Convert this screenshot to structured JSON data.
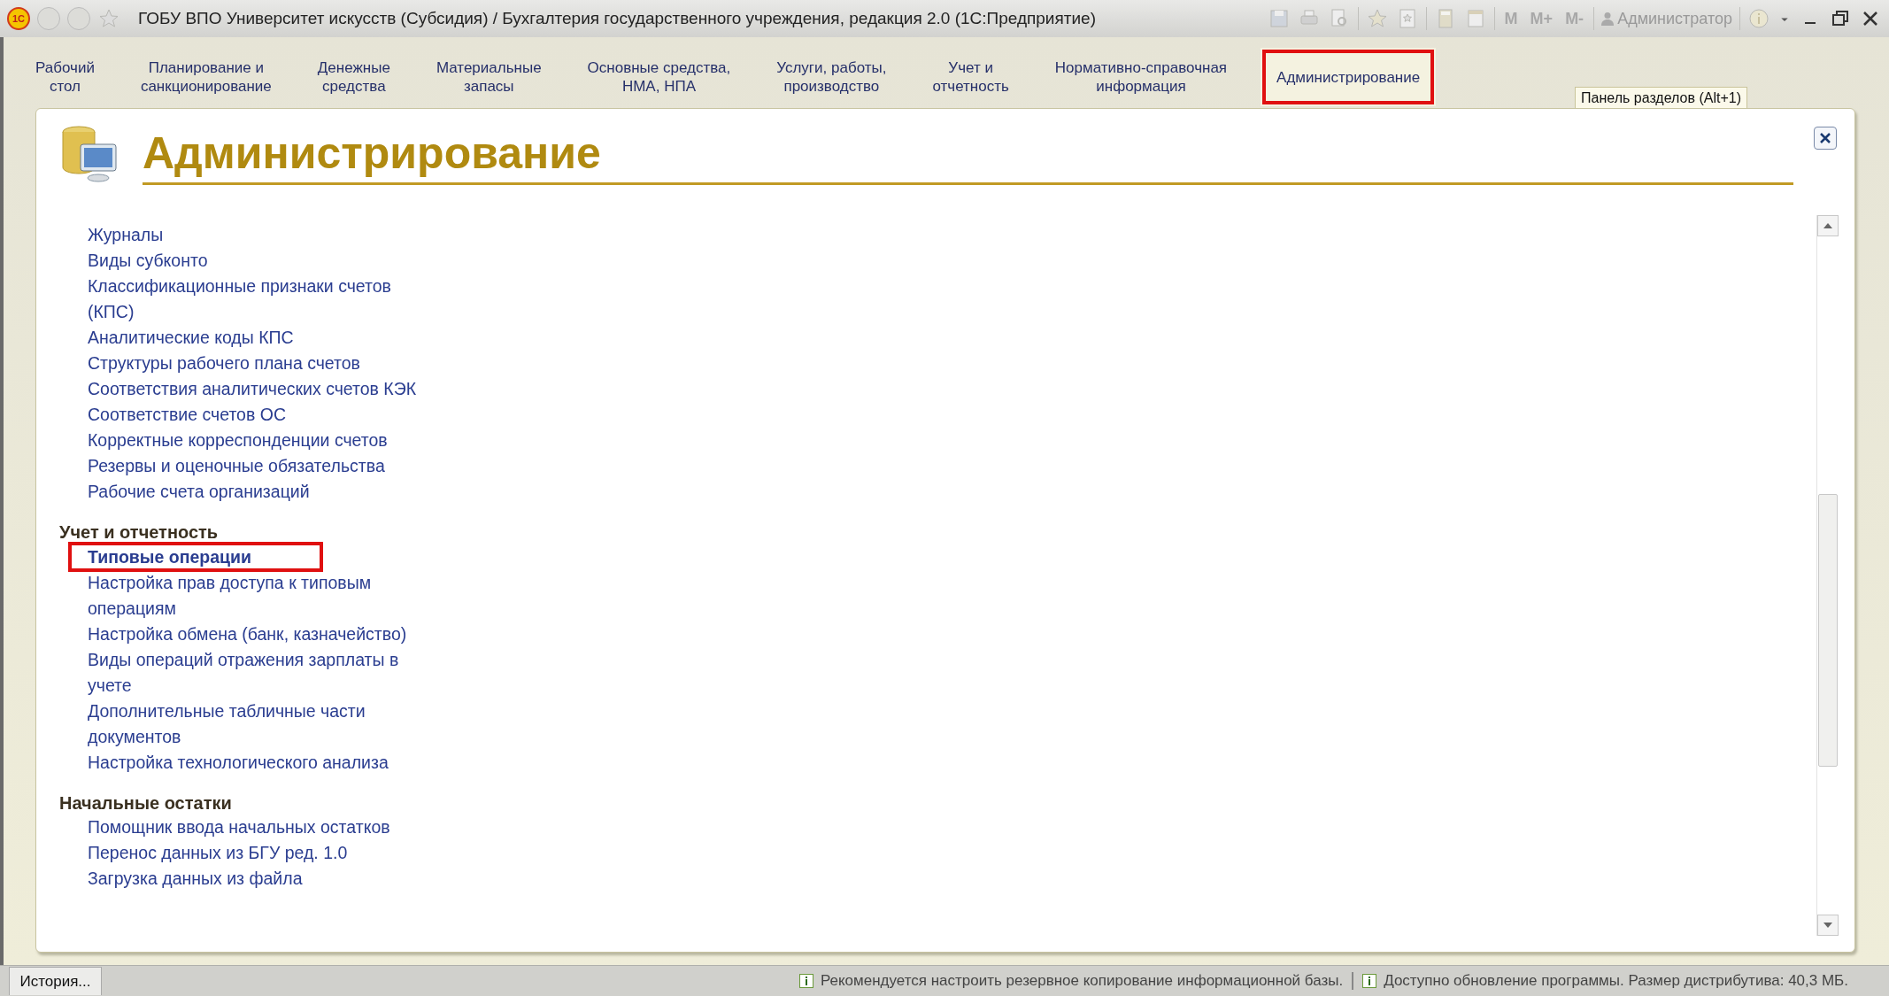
{
  "window": {
    "logo": "1С",
    "title": "ГОБУ ВПО Университет искусств (Субсидия) / Бухгалтерия государственного учреждения, редакция 2.0  (1С:Предприятие)",
    "memory_buttons": [
      "M",
      "M+",
      "M-"
    ],
    "user": "Администратор"
  },
  "sections": [
    {
      "label": "Рабочий\nстол",
      "selected": false
    },
    {
      "label": "Планирование и\nсанкционирование",
      "selected": false
    },
    {
      "label": "Денежные\nсредства",
      "selected": false
    },
    {
      "label": "Материальные\nзапасы",
      "selected": false
    },
    {
      "label": "Основные средства,\nНМА, НПА",
      "selected": false
    },
    {
      "label": "Услуги, работы,\nпроизводство",
      "selected": false
    },
    {
      "label": "Учет и\nотчетность",
      "selected": false
    },
    {
      "label": "Нормативно-справочная\nинформация",
      "selected": false
    },
    {
      "label": "Администрирование",
      "selected": true
    }
  ],
  "panel_hint": "Панель разделов (Alt+1)",
  "page": {
    "title": "Администрирование",
    "groups": [
      {
        "items": [
          {
            "label": "Журналы",
            "highlighted": false
          },
          {
            "label": "Виды субконто",
            "highlighted": false
          },
          {
            "label": "Классификационные признаки счетов (КПС)",
            "highlighted": false
          },
          {
            "label": "Аналитические коды КПС",
            "highlighted": false
          },
          {
            "label": "Структуры рабочего плана счетов",
            "highlighted": false
          },
          {
            "label": "Соответствия аналитических счетов КЭК",
            "highlighted": false
          },
          {
            "label": "Соответствие счетов ОС",
            "highlighted": false
          },
          {
            "label": "Корректные корреспонденции счетов",
            "highlighted": false
          },
          {
            "label": "Резервы и оценочные обязательства",
            "highlighted": false
          },
          {
            "label": "Рабочие счета организаций",
            "highlighted": false
          }
        ]
      },
      {
        "heading": "Учет и отчетность",
        "items": [
          {
            "label": "Типовые операции",
            "highlighted": true
          },
          {
            "label": "Настройка прав доступа к типовым операциям",
            "highlighted": false
          },
          {
            "label": "Настройка обмена (банк, казначейство)",
            "highlighted": false
          },
          {
            "label": "Виды операций отражения зарплаты в учете",
            "highlighted": false
          },
          {
            "label": "Дополнительные табличные части документов",
            "highlighted": false
          },
          {
            "label": "Настройка технологического анализа",
            "highlighted": false
          }
        ]
      },
      {
        "heading": "Начальные остатки",
        "items": [
          {
            "label": "Помощник ввода начальных остатков",
            "highlighted": false
          },
          {
            "label": "Перенос данных из БГУ ред. 1.0",
            "highlighted": false
          },
          {
            "label": "Загрузка данных из файла",
            "highlighted": false
          }
        ]
      }
    ]
  },
  "status_bar": {
    "history_button": "История...",
    "messages": [
      "Рекомендуется настроить резервное копирование информационной базы.",
      "Доступно обновление программы. Размер дистрибутива: 40,3 МБ."
    ]
  }
}
